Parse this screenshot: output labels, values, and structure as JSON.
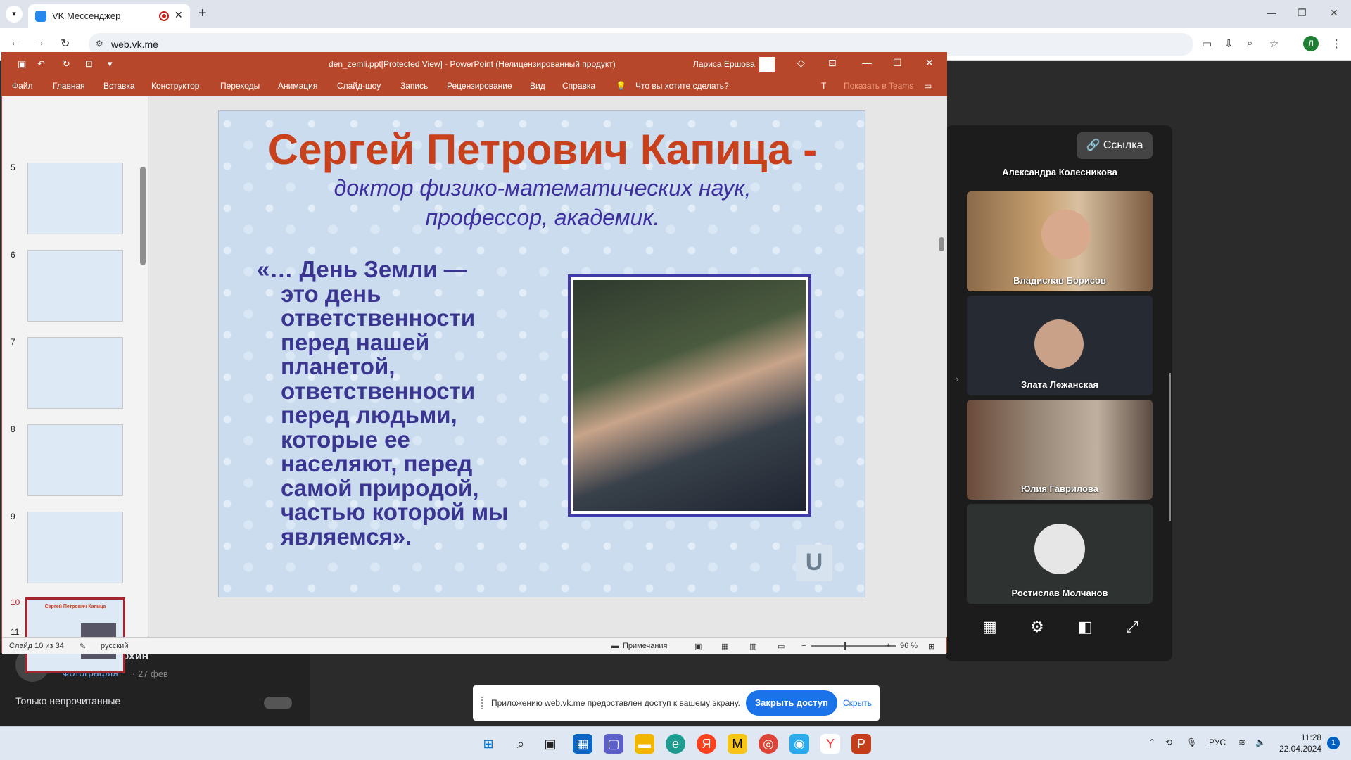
{
  "browser": {
    "tab_title": "VK Мессенджер",
    "url": "web.vk.me",
    "profile_initial": "Л"
  },
  "vk": {
    "chat_name": "Андрей Анохин",
    "chat_sub": "Фотография",
    "chat_time": "· 27 фев",
    "filter_label": "Только непрочитанные"
  },
  "call": {
    "link_label": "Ссылка",
    "participants": [
      {
        "name": "Александра Колесникова"
      },
      {
        "name": "Владислав Борисов"
      },
      {
        "name": "Злата Лежанская"
      },
      {
        "name": "Юлия Гаврилова"
      },
      {
        "name": "Ростислав Молчанов"
      }
    ]
  },
  "ppt": {
    "window_title": "den_zemli.ppt[Protected View]  -  PowerPoint (Нелицензированный продукт)",
    "user": "Лариса Ершова",
    "menu": [
      "Файл",
      "Главная",
      "Вставка",
      "Конструктор",
      "Переходы",
      "Анимация",
      "Слайд-шоу",
      "Запись",
      "Рецензирование",
      "Вид",
      "Справка"
    ],
    "tell_me": "Что вы хотите сделать?",
    "teams": "Показать в Teams",
    "thumbnails": [
      {
        "num": "5"
      },
      {
        "num": "6"
      },
      {
        "num": "7"
      },
      {
        "num": "8"
      },
      {
        "num": "9"
      },
      {
        "num": "10",
        "caption": "Сергей Петрович Капица"
      },
      {
        "num": "11"
      }
    ],
    "slide": {
      "title": "Сергей Петрович Капица  -",
      "subtitle_line1": "доктор физико-математических наук,",
      "subtitle_line2": "профессор, академик.",
      "quote_lines": [
        "«… День Земли —",
        "это день",
        "ответственности",
        "перед нашей",
        "планетой,",
        "ответственности",
        "перед людьми,",
        "которые ее",
        "населяют, перед",
        "самой природой,",
        "частью которой мы",
        "являемся»."
      ]
    },
    "status": {
      "slide_counter": "Слайд 10 из 34",
      "language": "русский",
      "notes": "Примечания",
      "zoom": "96 %"
    }
  },
  "share_banner": {
    "text": "Приложению web.vk.me предоставлен доступ к вашему экрану.",
    "stop_label": "Закрыть доступ",
    "hide_label": "Скрыть"
  },
  "taskbar": {
    "lang": "РУС",
    "time": "11:28",
    "date": "22.04.2024",
    "notifications": "1"
  }
}
